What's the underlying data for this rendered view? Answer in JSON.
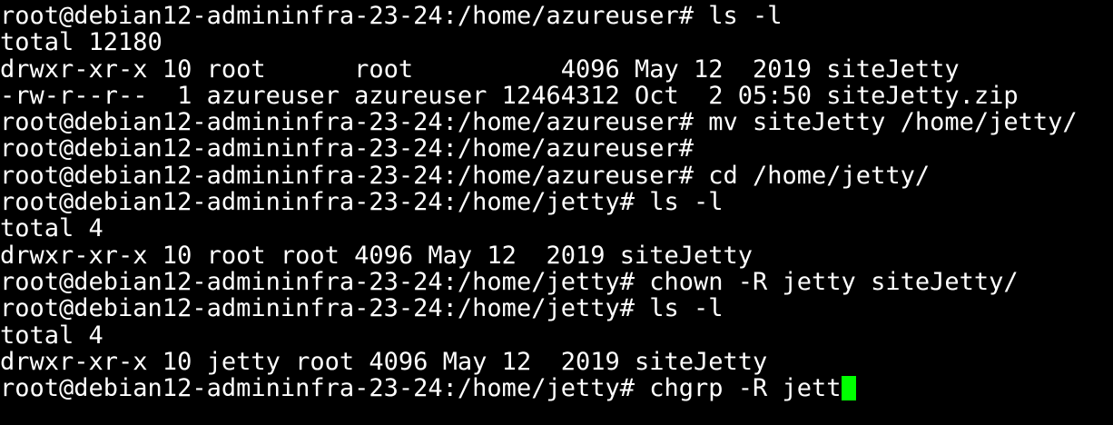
{
  "terminal": {
    "lines": [
      "root@debian12-admininfra-23-24:/home/azureuser# ls -l",
      "total 12180",
      "drwxr-xr-x 10 root      root          4096 May 12  2019 siteJetty",
      "-rw-r--r--  1 azureuser azureuser 12464312 Oct  2 05:50 siteJetty.zip",
      "root@debian12-admininfra-23-24:/home/azureuser# mv siteJetty /home/jetty/",
      "root@debian12-admininfra-23-24:/home/azureuser#",
      "root@debian12-admininfra-23-24:/home/azureuser# cd /home/jetty/",
      "root@debian12-admininfra-23-24:/home/jetty# ls -l",
      "total 4",
      "drwxr-xr-x 10 root root 4096 May 12  2019 siteJetty",
      "root@debian12-admininfra-23-24:/home/jetty# chown -R jetty siteJetty/",
      "root@debian12-admininfra-23-24:/home/jetty# ls -l",
      "total 4",
      "drwxr-xr-x 10 jetty root 4096 May 12  2019 siteJetty",
      "root@debian12-admininfra-23-24:/home/jetty# chgrp -R jett"
    ],
    "colors": {
      "background": "#000000",
      "foreground": "#ffffff",
      "cursor": "#00ff00"
    }
  }
}
